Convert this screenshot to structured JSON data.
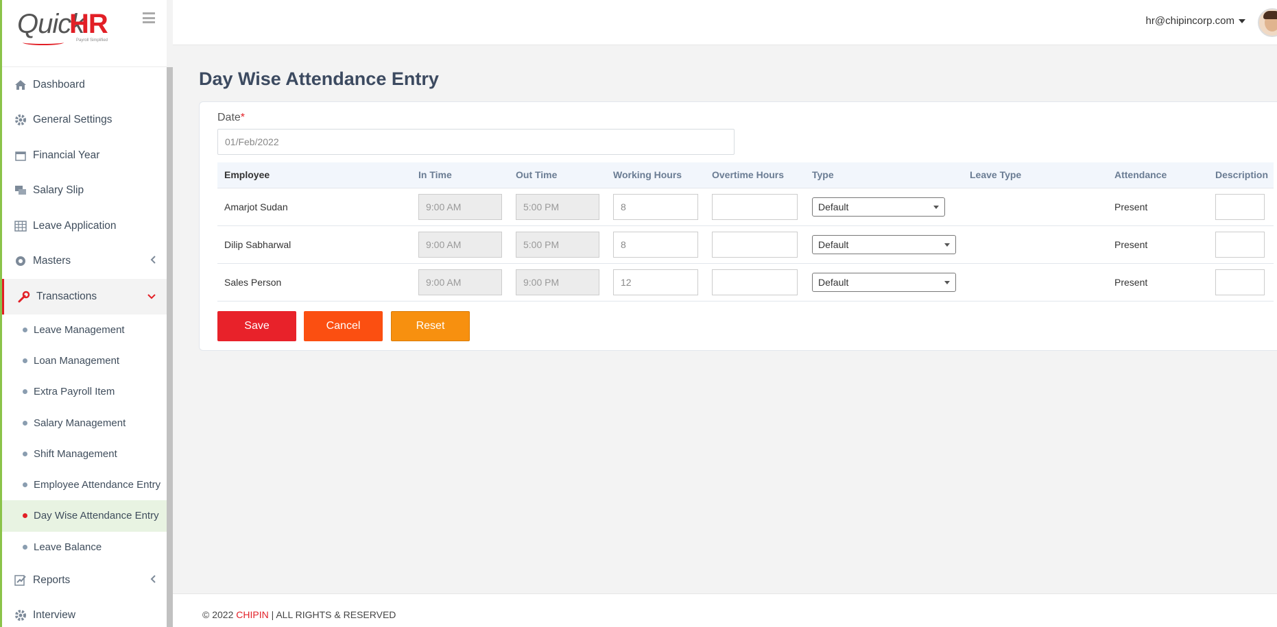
{
  "app": {
    "logo_text_a": "Quick",
    "logo_text_b": "HR",
    "logo_tagline": "Payroll Simplified"
  },
  "header": {
    "user_email": "hr@chipincorp.com"
  },
  "sidebar": {
    "items": [
      {
        "label": "Dashboard",
        "icon": "home-icon"
      },
      {
        "label": "General Settings",
        "icon": "gear-icon"
      },
      {
        "label": "Financial Year",
        "icon": "calendar-icon"
      },
      {
        "label": "Salary Slip",
        "icon": "chat-icon"
      },
      {
        "label": "Leave Application",
        "icon": "table-icon"
      },
      {
        "label": "Masters",
        "icon": "cog-icon"
      },
      {
        "label": "Transactions",
        "icon": "wrench-icon"
      }
    ],
    "sub_items": [
      {
        "label": "Leave Management"
      },
      {
        "label": "Loan Management"
      },
      {
        "label": "Extra Payroll Item"
      },
      {
        "label": "Salary Management"
      },
      {
        "label": "Shift Management"
      },
      {
        "label": "Employee Attendance Entry"
      },
      {
        "label": "Day Wise Attendance Entry"
      },
      {
        "label": "Leave Balance"
      }
    ],
    "after_items": [
      {
        "label": "Reports",
        "icon": "report-icon"
      },
      {
        "label": "Interview",
        "icon": "gear-icon"
      }
    ]
  },
  "main": {
    "title": "Day Wise Attendance Entry",
    "date_label": "Date",
    "date_required": "*",
    "date_value": "01/Feb/2022",
    "columns": [
      "Employee",
      "In Time",
      "Out Time",
      "Working Hours",
      "Overtime Hours",
      "Type",
      "Leave Type",
      "Attendance",
      "Description"
    ],
    "rows": [
      {
        "employee": "Amarjot Sudan",
        "in_time": "9:00 AM",
        "out_time": "5:00 PM",
        "working_hours": "8",
        "overtime_hours": "",
        "type": "Default",
        "leave_type": "",
        "attendance": "Present",
        "description": ""
      },
      {
        "employee": "Dilip Sabharwal",
        "in_time": "9:00 AM",
        "out_time": "5:00 PM",
        "working_hours": "8",
        "overtime_hours": "",
        "type": "Default",
        "leave_type": "",
        "attendance": "Present",
        "description": ""
      },
      {
        "employee": "Sales Person",
        "in_time": "9:00 AM",
        "out_time": "9:00 PM",
        "working_hours": "12",
        "overtime_hours": "",
        "type": "Default",
        "leave_type": "",
        "attendance": "Present",
        "description": ""
      }
    ],
    "buttons": {
      "save": "Save",
      "cancel": "Cancel",
      "reset": "Reset"
    }
  },
  "footer": {
    "prefix": "© 2022 ",
    "brand": "CHIPIN",
    "suffix": " | ALL RIGHTS & RESERVED"
  },
  "colors": {
    "accent": "#e21f26",
    "sidebar_border": "#8bc34a",
    "save": "#e8222a",
    "cancel": "#fb4f11",
    "reset": "#f7900f"
  }
}
